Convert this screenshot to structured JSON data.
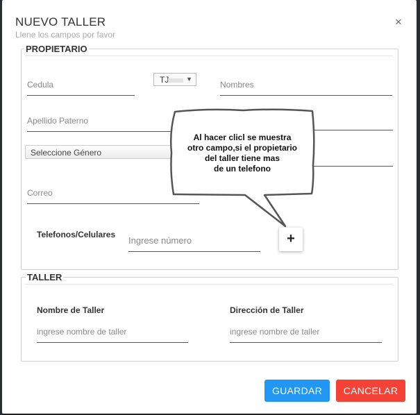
{
  "dialog": {
    "title": "NUEVO TALLER",
    "subtitle": "Llene los campos por favor",
    "close_glyph": "×"
  },
  "propietario": {
    "legend": "PROPIETARIO",
    "cedula_placeholder": "Cedula",
    "doc_type_value": "TJ",
    "nombres_placeholder": "Nombres",
    "apellido_paterno_placeholder": "Apellido Paterno",
    "genero_value": "Seleccione Género",
    "correo_placeholder": "Correo",
    "telefonos_label": "Telefonos/Celulares",
    "telefono_placeholder": "Ingrese número",
    "add_phone_glyph": "+"
  },
  "taller": {
    "legend": "TALLER",
    "nombre_label": "Nombre de Taller",
    "nombre_placeholder": "ingrese nombre de taller",
    "direccion_label": "Dirección de Taller",
    "direccion_placeholder": "ingrese nombre de taller"
  },
  "callout": {
    "lines": [
      "Al hacer clicl se muestra",
      "otro campo,si el propietario",
      "del taller tiene mas",
      "de un telefono"
    ]
  },
  "actions": {
    "save_label": "GUARDAR",
    "cancel_label": "CANCELAR"
  },
  "colors": {
    "save": "#2196f3",
    "cancel": "#f44336"
  }
}
